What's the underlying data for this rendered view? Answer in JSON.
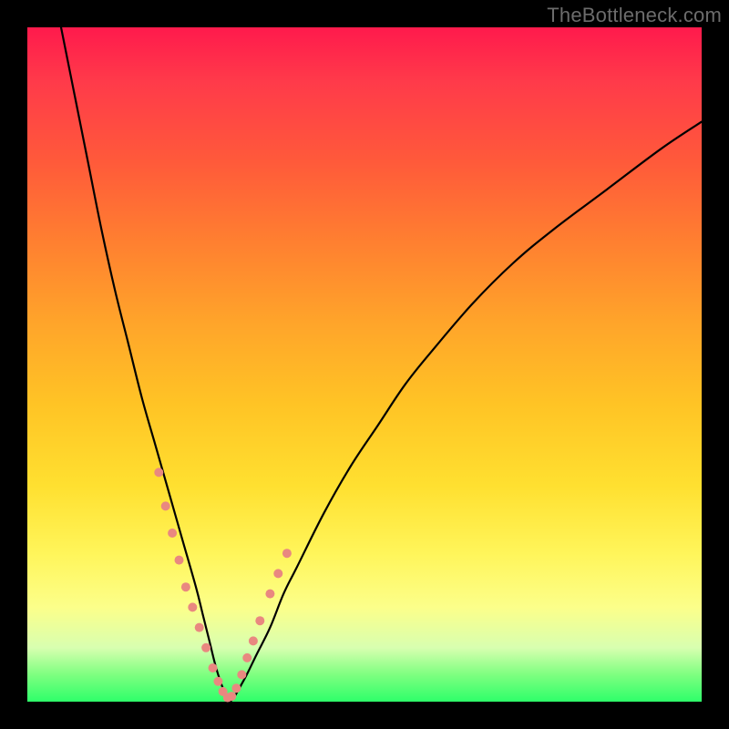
{
  "watermark": "TheBottleneck.com",
  "chart_data": {
    "type": "line",
    "title": "",
    "xlabel": "",
    "ylabel": "",
    "xlim": [
      0,
      100
    ],
    "ylim": [
      0,
      100
    ],
    "series": [
      {
        "name": "bottleneck-curve",
        "x": [
          5,
          7,
          9,
          11,
          13,
          15,
          17,
          19,
          21,
          23,
          25,
          26,
          27,
          28,
          29,
          30,
          32,
          34,
          36,
          38,
          40,
          44,
          48,
          52,
          56,
          60,
          66,
          72,
          78,
          86,
          94,
          100
        ],
        "values": [
          100,
          90,
          80,
          70,
          61,
          53,
          45,
          38,
          31,
          24,
          17,
          13,
          9,
          5,
          2,
          0,
          3,
          7,
          11,
          16,
          20,
          28,
          35,
          41,
          47,
          52,
          59,
          65,
          70,
          76,
          82,
          86
        ]
      }
    ],
    "markers": {
      "name": "highlight-points",
      "x": [
        19.5,
        20.5,
        21.5,
        22.5,
        23.5,
        24.5,
        25.5,
        26.5,
        27.5,
        28.3,
        29.0,
        29.7,
        30.3,
        31.0,
        31.8,
        32.6,
        33.5,
        34.5,
        36.0,
        37.2,
        38.5
      ],
      "values": [
        34,
        29,
        25,
        21,
        17,
        14,
        11,
        8,
        5,
        3,
        1.5,
        0.6,
        0.8,
        2,
        4,
        6.5,
        9,
        12,
        16,
        19,
        22
      ],
      "color": "#e98880",
      "size": 10
    },
    "background_gradient": {
      "top": "#ff1a4c",
      "mid": "#ffe030",
      "bottom": "#2eff6a"
    }
  }
}
